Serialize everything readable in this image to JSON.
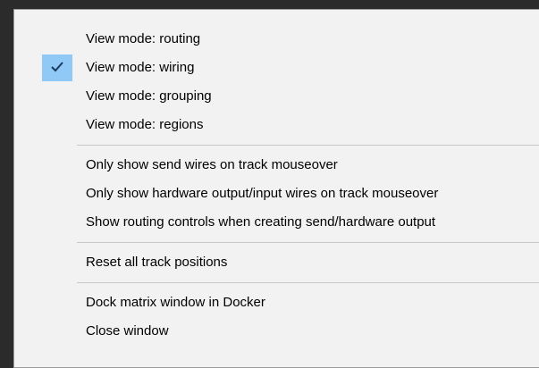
{
  "menu": {
    "groups": [
      {
        "items": [
          {
            "label": "View mode: routing",
            "checked": false
          },
          {
            "label": "View mode: wiring",
            "checked": true
          },
          {
            "label": "View mode: grouping",
            "checked": false
          },
          {
            "label": "View mode: regions",
            "checked": false
          }
        ]
      },
      {
        "items": [
          {
            "label": "Only show send wires on track mouseover"
          },
          {
            "label": "Only show hardware output/input wires on track mouseover"
          },
          {
            "label": "Show routing controls when creating send/hardware output"
          }
        ]
      },
      {
        "items": [
          {
            "label": "Reset all track positions"
          }
        ]
      },
      {
        "items": [
          {
            "label": "Dock matrix window in Docker"
          },
          {
            "label": "Close window"
          }
        ]
      }
    ],
    "check_highlight_color": "#90c8f6",
    "checkmark_icon": "checkmark-icon"
  }
}
